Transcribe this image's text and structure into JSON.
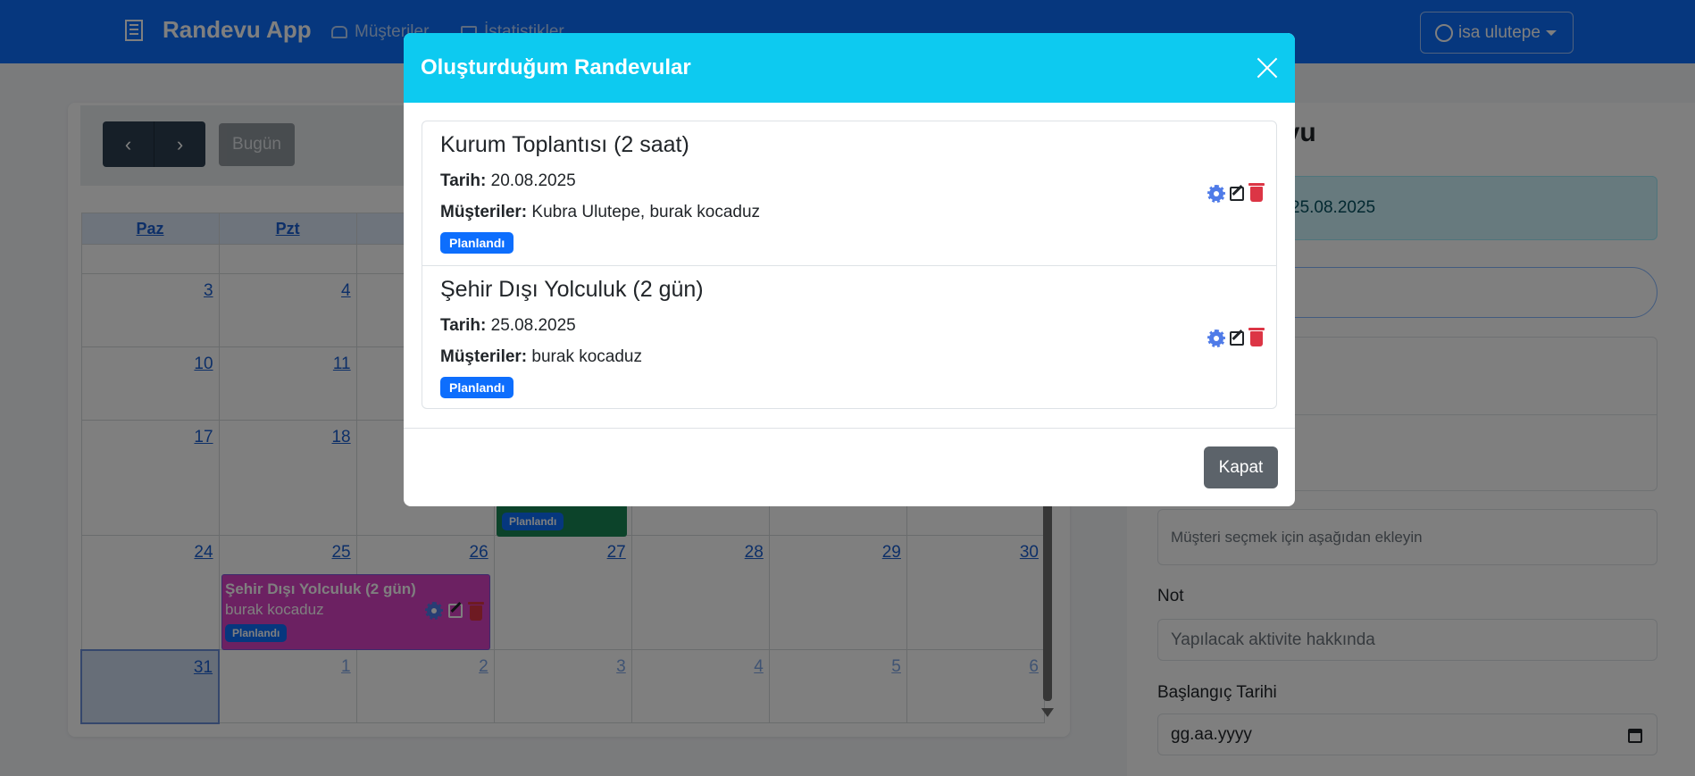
{
  "navbar": {
    "brand": "Randevu App",
    "links": [
      "Müşteriler",
      "İstatistikler"
    ],
    "user": "isa ulutepe"
  },
  "calendar": {
    "today_label": "Bugün",
    "weekdays": [
      "Paz",
      "Pzt",
      "",
      "",
      "",
      "",
      ""
    ],
    "weeks": [
      [
        "",
        "",
        "",
        "",
        "",
        "",
        ""
      ],
      [
        "3",
        "4",
        "",
        "",
        "",
        "",
        ""
      ],
      [
        "10",
        "11",
        "",
        "",
        "",
        "",
        ""
      ],
      [
        "17",
        "18",
        "",
        "",
        "",
        "",
        ""
      ],
      [
        "24",
        "25",
        "26",
        "27",
        "28",
        "29",
        "30"
      ],
      [
        "31",
        "1",
        "2",
        "3",
        "4",
        "5",
        "6"
      ]
    ],
    "event_pink": {
      "title": "Şehir Dışı Yolculuk (2 gün)",
      "subtitle": "burak kocaduz",
      "badge": "Planlandı"
    },
    "event_green_badge": "Planlandı"
  },
  "form": {
    "title": "evu",
    "info_text": "25.08.2025",
    "customer_hint": "Müşteri seçmek için aşağıdan ekleyin",
    "note_label": "Not",
    "note_placeholder": "Yapılacak aktivite hakkında",
    "start_label": "Başlangıç Tarihi",
    "start_placeholder": "gg.aa.yyyy"
  },
  "modal": {
    "title": "Oluşturduğum Randevular",
    "close_button": "Kapat",
    "items": [
      {
        "title": "Kurum Toplantısı (2 saat)",
        "date_label": "Tarih:",
        "date": "20.08.2025",
        "customers_label": "Müşteriler:",
        "customers": "Kubra Ulutepe, burak kocaduz",
        "status": "Planlandı"
      },
      {
        "title": "Şehir Dışı Yolculuk (2 gün)",
        "date_label": "Tarih:",
        "date": "25.08.2025",
        "customers_label": "Müşteriler:",
        "customers": "burak kocaduz",
        "status": "Planlandı"
      }
    ]
  },
  "colors": {
    "navbar": "#0d6efd",
    "modal_header": "#0dcaf0",
    "badge": "#0d6efd",
    "event_pink": "#d943c4",
    "delete_icon": "#dc3545",
    "settings_icon": "#4f7be8"
  }
}
